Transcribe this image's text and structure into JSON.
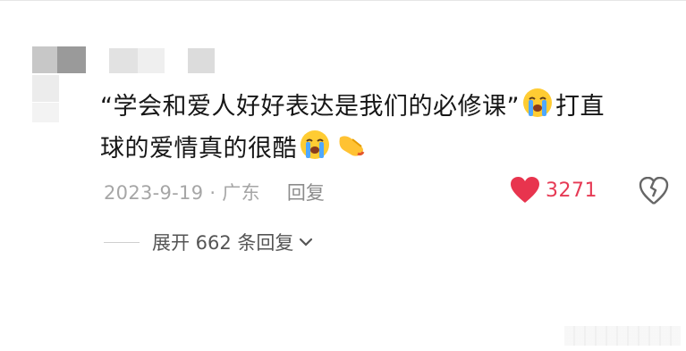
{
  "comment": {
    "line1_text": "“学会和爱人好好表达是我们的必修课”",
    "line1_tail": "打直",
    "line2_text": "球的爱情真的很酷",
    "emoji_1": "loudly-crying-face-icon",
    "emoji_2": "loudly-crying-face-icon",
    "emoji_3": "pointing-hand-icon"
  },
  "meta": {
    "date_location": "2023-9-19 · 广东",
    "reply_label": "回复"
  },
  "like": {
    "icon": "heart-icon",
    "count": "3271",
    "color": "#e8344e"
  },
  "dislike": {
    "icon": "broken-heart-icon"
  },
  "replies": {
    "expand_label": "展开 662 条回复",
    "icon": "chevron-down-icon"
  }
}
